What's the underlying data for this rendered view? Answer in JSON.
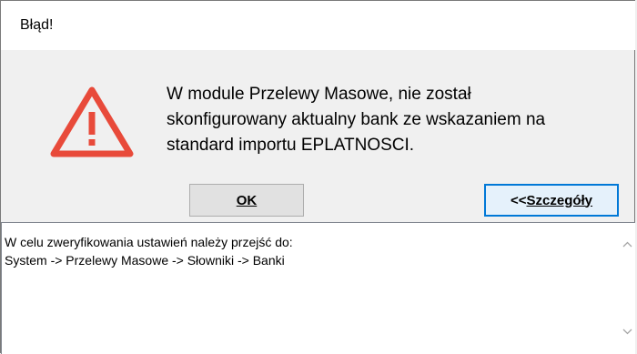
{
  "dialog": {
    "title": "Błąd!",
    "icon": "warning-triangle-icon",
    "accent_color": "#e84a3a",
    "message_lines": [
      "W module Przelewy Masowe, nie został",
      "skonfigurowany aktualny bank ze wskazaniem na",
      "standard importu EPLATNOSCI."
    ]
  },
  "buttons": {
    "ok": {
      "label": "OK"
    },
    "details": {
      "label_prefix": "<<",
      "label_rest": "Szczegóły"
    }
  },
  "details": {
    "lines": [
      "W celu zweryfikowania ustawień należy przejść do:",
      "System -> Przelewy Masowe -> Słowniki -> Banki"
    ],
    "scroll_up_icon": "chevron-up-icon",
    "scroll_down_icon": "chevron-down-icon"
  }
}
